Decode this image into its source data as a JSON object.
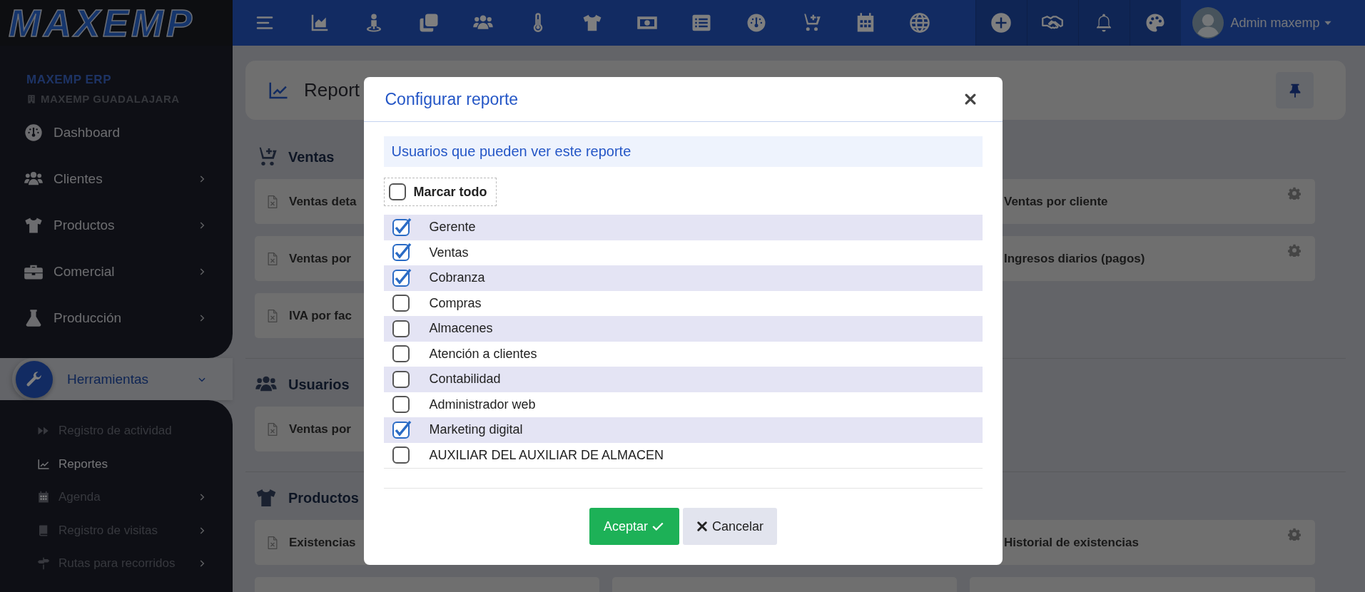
{
  "logo": {
    "text": "MAXEMP"
  },
  "topbar": {
    "user": "Admin maxemp"
  },
  "sidebar": {
    "company": "MAXEMP ERP",
    "branch": "MAXEMP GUADALAJARA",
    "items": [
      {
        "label": "Dashboard",
        "kind": "link",
        "selected": false
      },
      {
        "label": "Clientes",
        "kind": "group",
        "expanded": false,
        "selected": false
      },
      {
        "label": "Productos",
        "kind": "group",
        "expanded": false,
        "selected": false
      },
      {
        "label": "Comercial",
        "kind": "group",
        "expanded": false,
        "selected": false
      },
      {
        "label": "Producción",
        "kind": "group",
        "expanded": false,
        "selected": false
      },
      {
        "label": "Herramientas",
        "kind": "group",
        "expanded": true,
        "selected": true,
        "children": [
          {
            "label": "Registro de actividad",
            "kind": "link",
            "selected": false
          },
          {
            "label": "Reportes",
            "kind": "link",
            "selected": true
          },
          {
            "label": "Agenda",
            "kind": "group",
            "expanded": false,
            "selected": false
          },
          {
            "label": "Registro de visitas",
            "kind": "group",
            "expanded": false,
            "selected": false
          },
          {
            "label": "Rutas para recorridos",
            "kind": "group",
            "expanded": false,
            "selected": false
          }
        ]
      }
    ]
  },
  "page": {
    "title": "Report",
    "sections": [
      {
        "title": "Ventas",
        "rows": [
          {
            "left": "Ventas deta",
            "right": "Ventas por cliente"
          },
          {
            "left": "Ventas por",
            "right": "Ingresos diarios (pagos)"
          },
          {
            "left": "IVA por fac"
          }
        ]
      },
      {
        "title": "Usuarios",
        "rows": [
          {
            "left": "Ventas por"
          }
        ]
      },
      {
        "title": "Productos",
        "rows": [
          {
            "left": "Existencias",
            "right": "Historial de existencias"
          }
        ]
      }
    ]
  },
  "modal": {
    "title": "Configurar reporte",
    "subtitle": "Usuarios que pueden ver este reporte",
    "select_all": {
      "label": "Marcar todo",
      "checked": false
    },
    "users": [
      {
        "name": "Gerente",
        "checked": true
      },
      {
        "name": "Ventas",
        "checked": true
      },
      {
        "name": "Cobranza",
        "checked": true
      },
      {
        "name": "Compras",
        "checked": false
      },
      {
        "name": "Almacenes",
        "checked": false
      },
      {
        "name": "Atención a clientes",
        "checked": false
      },
      {
        "name": "Contabilidad",
        "checked": false
      },
      {
        "name": "Administrador web",
        "checked": false
      },
      {
        "name": "Marketing digital",
        "checked": true
      },
      {
        "name": "AUXILIAR DEL AUXILIAR DE ALMACEN",
        "checked": false
      }
    ],
    "buttons": [
      {
        "label": "Aceptar",
        "kind": "primary"
      },
      {
        "label": "Cancelar",
        "kind": "secondary"
      }
    ]
  }
}
